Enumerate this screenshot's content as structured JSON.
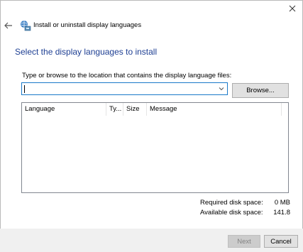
{
  "window": {
    "title": "Install or uninstall display languages",
    "close_icon": "close-icon",
    "back_icon": "back-arrow-icon",
    "app_icon": "globe-language-icon"
  },
  "main": {
    "heading": "Select the display languages to install",
    "prompt": "Type or browse to the location that contains the display language files:",
    "path_input": {
      "value": "",
      "placeholder": ""
    },
    "browse_label": "Browse..."
  },
  "list": {
    "columns": [
      "Language",
      "Ty...",
      "Size",
      "Message"
    ],
    "rows": []
  },
  "disk": {
    "required_label": "Required disk space:",
    "required_value": "0 MB",
    "available_label": "Available disk space:",
    "available_value": "141.8"
  },
  "footer": {
    "next_label": "Next",
    "cancel_label": "Cancel"
  },
  "colors": {
    "heading": "#1e3f93",
    "input_border": "#1a79c9",
    "footer_bg": "#f0f0f0"
  }
}
